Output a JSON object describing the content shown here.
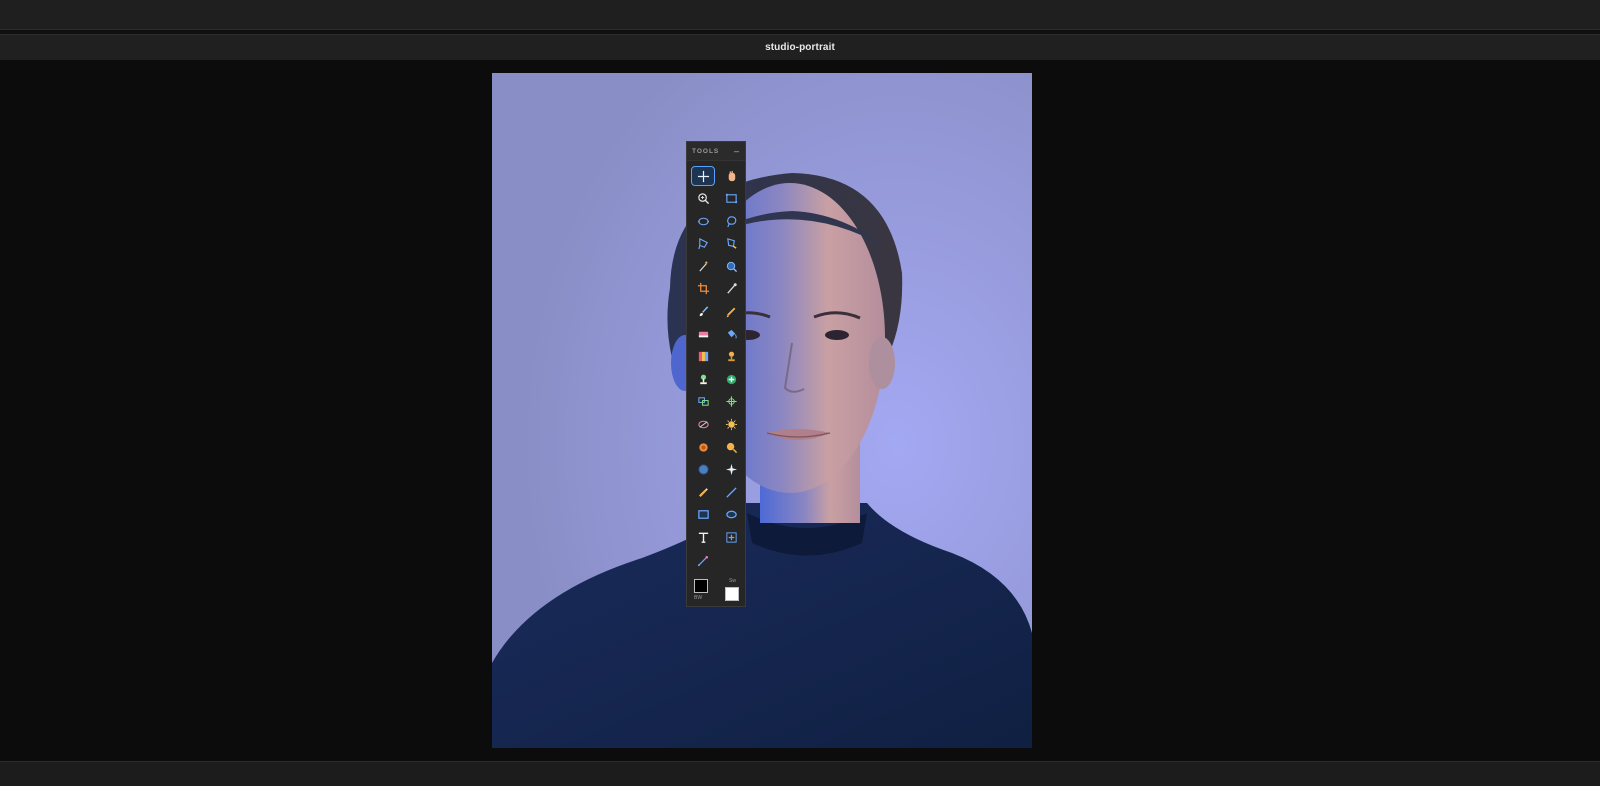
{
  "document": {
    "title": "studio-portrait"
  },
  "tools_panel": {
    "title": "TOOLS",
    "collapse_label": "–",
    "active_tool": "move",
    "tools": [
      {
        "name": "move",
        "icon": "move-icon"
      },
      {
        "name": "hand",
        "icon": "hand-icon"
      },
      {
        "name": "zoom",
        "icon": "zoom-icon"
      },
      {
        "name": "rect-select",
        "icon": "rect-select-icon"
      },
      {
        "name": "ellipse-select",
        "icon": "ellipse-select-icon"
      },
      {
        "name": "lasso",
        "icon": "lasso-icon"
      },
      {
        "name": "polygon-lasso",
        "icon": "polygon-lasso-icon"
      },
      {
        "name": "magnetic-lasso",
        "icon": "magnetic-lasso-icon"
      },
      {
        "name": "magic-wand",
        "icon": "magic-wand-icon"
      },
      {
        "name": "quick-select",
        "icon": "quick-select-icon"
      },
      {
        "name": "crop",
        "icon": "crop-icon"
      },
      {
        "name": "eyedropper",
        "icon": "eyedropper-icon"
      },
      {
        "name": "brush",
        "icon": "brush-icon"
      },
      {
        "name": "pencil",
        "icon": "pencil-icon"
      },
      {
        "name": "eraser",
        "icon": "eraser-icon"
      },
      {
        "name": "paint-bucket",
        "icon": "paint-bucket-icon"
      },
      {
        "name": "gradient",
        "icon": "gradient-icon"
      },
      {
        "name": "clone-stamp",
        "icon": "clone-stamp-icon"
      },
      {
        "name": "pattern-stamp",
        "icon": "pattern-stamp-icon"
      },
      {
        "name": "healing",
        "icon": "healing-icon"
      },
      {
        "name": "patch",
        "icon": "patch-icon"
      },
      {
        "name": "red-eye",
        "icon": "red-eye-icon"
      },
      {
        "name": "blur",
        "icon": "blur-icon"
      },
      {
        "name": "sharpen",
        "icon": "sharpen-icon"
      },
      {
        "name": "dodge",
        "icon": "dodge-icon"
      },
      {
        "name": "burn",
        "icon": "burn-icon"
      },
      {
        "name": "sponge",
        "icon": "sponge-icon"
      },
      {
        "name": "sparkle",
        "icon": "sparkle-icon"
      },
      {
        "name": "smudge",
        "icon": "smudge-icon"
      },
      {
        "name": "line",
        "icon": "line-icon"
      },
      {
        "name": "rectangle",
        "icon": "rectangle-icon"
      },
      {
        "name": "ellipse",
        "icon": "ellipse-icon"
      },
      {
        "name": "text",
        "icon": "text-icon"
      },
      {
        "name": "transform",
        "icon": "transform-icon"
      },
      {
        "name": "pen",
        "icon": "pen-icon"
      }
    ],
    "foreground_color": "#000000",
    "background_color": "#ffffff",
    "fg_label": "BW",
    "swap_label": "Sw"
  },
  "colors": {
    "accent": "#5aa0ff",
    "panel": "#262626",
    "canvas": "#0c0c0c"
  }
}
